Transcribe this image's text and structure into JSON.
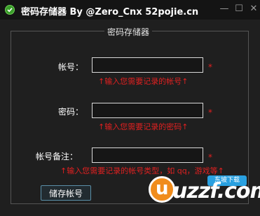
{
  "window": {
    "title": "密码存储器 By @Zero_Cnx 52pojie.cn",
    "minimize_glyph": "—",
    "maximize_glyph": "☐",
    "close_glyph": "✕"
  },
  "group": {
    "title": "密码存储器"
  },
  "fields": [
    {
      "label": "帐号：",
      "value": "",
      "required_mark": "*",
      "hint": "↑输入您需要记录的帐号↑"
    },
    {
      "label": "密码：",
      "value": "",
      "required_mark": "*",
      "hint": "↑输入您需要记录的密码↑"
    },
    {
      "label": "帐号备注：",
      "value": "",
      "required_mark": "*",
      "hint": "↑输入您需要记录的帐号类型，如 qq，游戏等↑"
    }
  ],
  "actions": {
    "save_label": "储存帐号"
  },
  "watermark": {
    "logo_letter": "u",
    "text": "uzzf.com",
    "tag": "东坡下载"
  },
  "colors": {
    "background": "#1f1f1f",
    "titlebar": "#141414",
    "accent_red": "#e02020",
    "input_border": "#d9d9d9",
    "button_border": "#5a8fa8"
  },
  "icons": {
    "app": "green-check-circle-icon",
    "minimize": "minimize-icon",
    "maximize": "maximize-icon",
    "close": "close-icon"
  }
}
